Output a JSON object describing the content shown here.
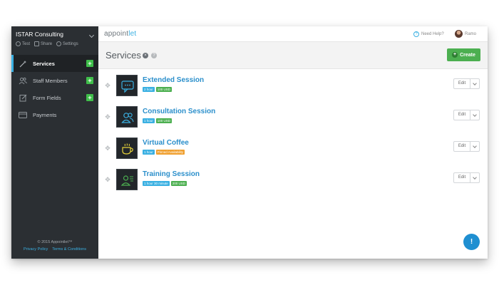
{
  "sidebar": {
    "org_name": "ISTAR Consulting",
    "actions": [
      {
        "label": "Test",
        "icon": "test-icon"
      },
      {
        "label": "Share",
        "icon": "share-icon"
      },
      {
        "label": "Settings",
        "icon": "gear-icon"
      }
    ],
    "items": [
      {
        "label": "Services",
        "icon": "wand-icon",
        "active": true,
        "has_add": true
      },
      {
        "label": "Staff Members",
        "icon": "users-icon",
        "active": false,
        "has_add": true
      },
      {
        "label": "Form Fields",
        "icon": "form-icon",
        "active": false,
        "has_add": true
      },
      {
        "label": "Payments",
        "icon": "card-icon",
        "active": false,
        "has_add": false
      }
    ],
    "add_symbol": "+",
    "copyright": "© 2015 Appointlet™",
    "privacy_link": "Privacy Policy",
    "terms_link": "Terms & Conditions"
  },
  "topbar": {
    "logo_prefix": "appoint",
    "logo_suffix": "let",
    "help_label": "Need Help?",
    "user_name": "Ramo"
  },
  "header": {
    "title": "Services",
    "create_label": "Create"
  },
  "services": [
    {
      "name": "Extended Session",
      "icon": "chat-bubble-icon",
      "icon_color": "#3ab0e2",
      "tags": [
        {
          "text": "2 hour",
          "color": "blue"
        },
        {
          "text": "100 USD",
          "color": "green"
        }
      ]
    },
    {
      "name": "Consultation Session",
      "icon": "users-icon",
      "icon_color": "#3ab0e2",
      "tags": [
        {
          "text": "1 hour",
          "color": "blue"
        },
        {
          "text": "100 USD",
          "color": "green"
        }
      ]
    },
    {
      "name": "Virtual Coffee",
      "icon": "coffee-icon",
      "icon_color": "#e6d23a",
      "tags": [
        {
          "text": "1 hour",
          "color": "blue"
        },
        {
          "text": "Pinned Availability",
          "color": "orange"
        }
      ]
    },
    {
      "name": "Training Session",
      "icon": "trainer-icon",
      "icon_color": "#4caf50",
      "tags": [
        {
          "text": "1 hour 30 minute",
          "color": "blue"
        },
        {
          "text": "200 USD",
          "color": "green"
        }
      ]
    }
  ],
  "edit_label": "Edit",
  "colors": {
    "accent": "#3ab0e2",
    "sidebar_bg": "#2b2f33",
    "create_green": "#4caf50",
    "service_name": "#2b8fcb"
  }
}
